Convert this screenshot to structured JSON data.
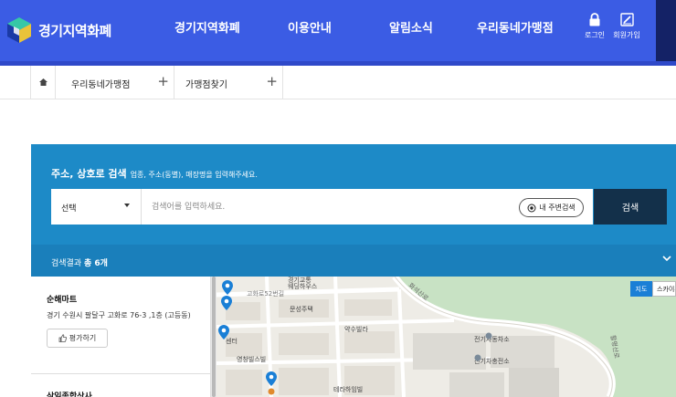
{
  "header": {
    "logo_text": "경기지역화폐",
    "nav": [
      "경기지역화폐",
      "이용안내",
      "알림소식",
      "우리동네가맹점"
    ],
    "login_label": "로그인",
    "signup_label": "회원가입"
  },
  "breadcrumb": {
    "items": [
      "우리동네가맹점",
      "가맹점찾기"
    ]
  },
  "search": {
    "title": "주소, 상호로 검색",
    "subtitle": "업종, 주소(동별), 매장명을 입력해주세요.",
    "select_value": "선택",
    "input_placeholder": "검색어를 입력하세요.",
    "input_value": "",
    "near_label": "내 주변검색",
    "submit_label": "검색"
  },
  "results": {
    "prefix": "검색결과",
    "count_label": "총 6개",
    "stores": [
      {
        "name": "순해마트",
        "address": "경기 수원시 팔달구 고화로 76-3 ,1층 (고등동)",
        "rate_label": "평가하기"
      },
      {
        "name": "삼일종합상사"
      }
    ]
  },
  "map": {
    "type_labels": [
      "지도",
      "스카이뷰"
    ],
    "labels": [
      "경기교통",
      "웨딩하우스",
      "고화로52번길",
      "문성주택",
      "약수빌라",
      "센터",
      "영창빌스빌",
      "테라하임빌",
      "전기자동차소",
      "진기차충전소",
      "화석산로",
      "활평산로"
    ]
  },
  "colors": {
    "header_bg": "#3b5ce4",
    "search_bg": "#1d8ac7",
    "result_bar_bg": "#1a7fbb",
    "submit_bg": "#13304a",
    "map_marker": "#1a7fd6"
  }
}
